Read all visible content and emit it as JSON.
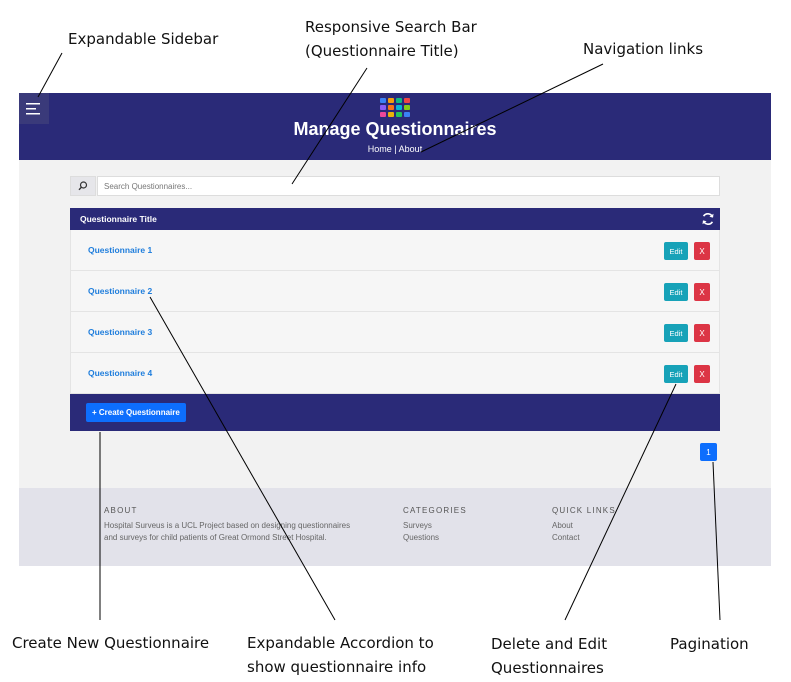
{
  "annotations": {
    "sidebar": "Expandable Sidebar",
    "search_line1": "Responsive Search Bar",
    "search_line2": "(Questionnaire Title)",
    "nav": "Navigation links",
    "create_new": "Create New Questionnaire",
    "accordion_line1": "Expandable Accordion to",
    "accordion_line2": "show questionnaire info",
    "delete_edit_line1": "Delete and Edit",
    "delete_edit_line2": "Questionnaires",
    "pagination": "Pagination"
  },
  "header": {
    "title": "Manage Questionnaires",
    "nav_home": "Home",
    "nav_separator": "|",
    "nav_about": "About",
    "logo_colors": [
      "#3b82f6",
      "#f59e0b",
      "#10b981",
      "#ef4444",
      "#8b5cf6",
      "#f97316",
      "#06b6d4",
      "#84cc16",
      "#ec4899",
      "#eab308",
      "#22c55e",
      "#3b82f6"
    ]
  },
  "icons": {
    "menu": "hamburger-icon",
    "search": "search-icon",
    "refresh": "refresh-icon"
  },
  "search": {
    "placeholder": "Search Questionnaires..."
  },
  "accordion": {
    "header": "Questionnaire Title",
    "rows": [
      {
        "title": "Questionnaire 1",
        "edit": "Edit",
        "delete": "X"
      },
      {
        "title": "Questionnaire 2",
        "edit": "Edit",
        "delete": "X"
      },
      {
        "title": "Questionnaire 3",
        "edit": "Edit",
        "delete": "X"
      },
      {
        "title": "Questionnaire 4",
        "edit": "Edit",
        "delete": "X"
      }
    ],
    "create_button": "+ Create Questionnaire"
  },
  "pagination": {
    "current_page": "1"
  },
  "footer": {
    "about_heading": "ABOUT",
    "about_line1": "Hospital Surveus is a UCL Project based on designing questionnaires",
    "about_line2": "and surveys for child patients of Great Ormond Street Hospital.",
    "categories_heading": "CATEGORIES",
    "categories": [
      "Surveys",
      "Questions"
    ],
    "quick_links_heading": "QUICK LINKS",
    "quick_links": [
      "About",
      "Contact"
    ]
  },
  "colors": {
    "header_bg": "#2a2a78",
    "edit_button": "#17a2b8",
    "delete_button": "#dc3545",
    "primary_button": "#0d6efd",
    "link": "#1e7ddc",
    "footer_bg": "#e2e2ea"
  }
}
